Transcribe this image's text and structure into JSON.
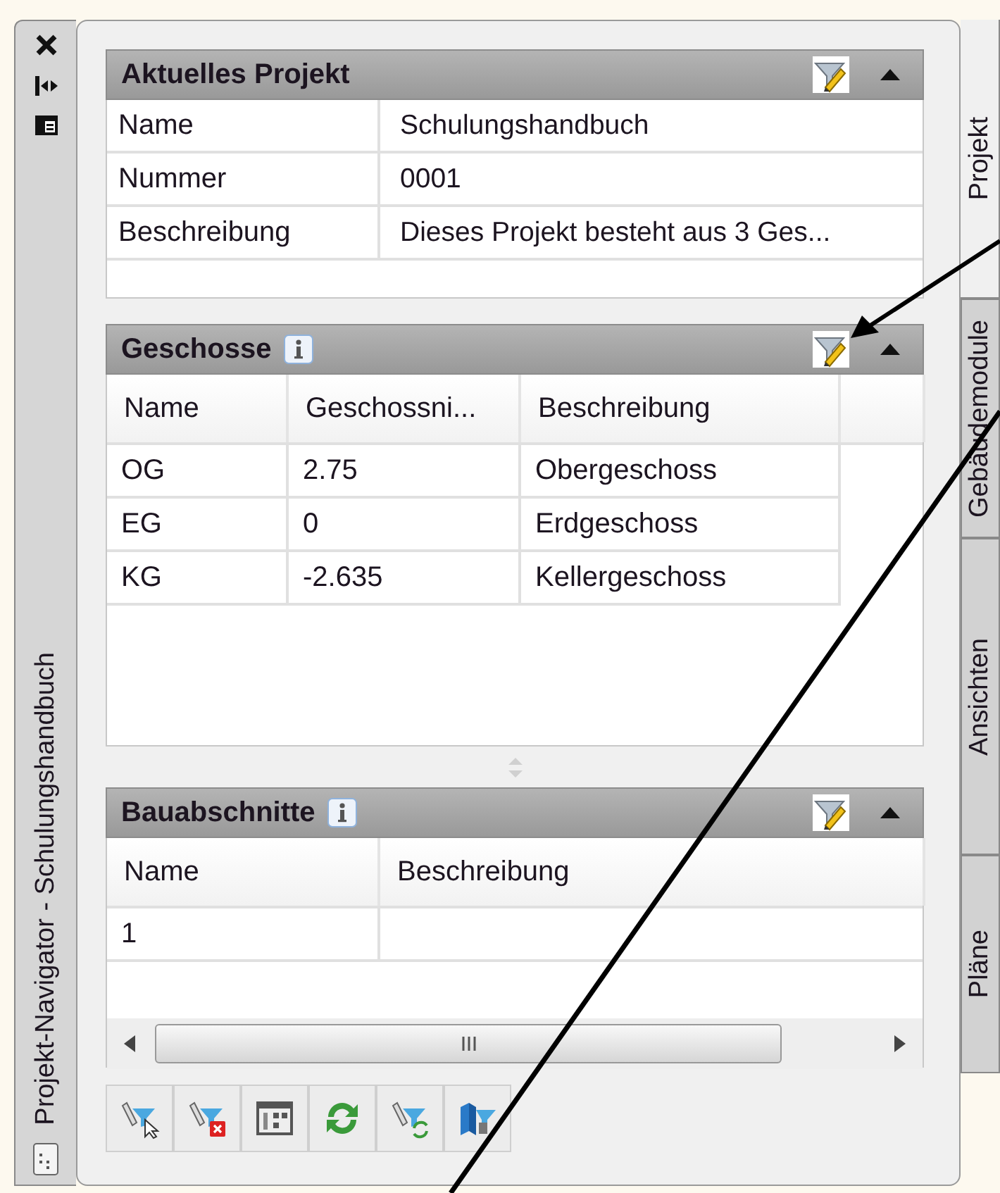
{
  "side_strip": {
    "title": "Projekt-Navigator - Schulungshandbuch"
  },
  "sections": [
    {
      "kind": "properties",
      "title": "Aktuelles Projekt",
      "info": false,
      "rows": [
        {
          "label": "Name",
          "value": "Schulungshandbuch"
        },
        {
          "label": "Nummer",
          "value": "0001"
        },
        {
          "label": "Beschreibung",
          "value": "Dieses Projekt besteht aus 3 Ges..."
        }
      ]
    },
    {
      "kind": "table",
      "title": "Geschosse",
      "info": true,
      "columns": [
        "Name",
        "Geschossni...",
        "Beschreibung"
      ],
      "rows": [
        [
          "OG",
          "2.75",
          "Obergeschoss"
        ],
        [
          "EG",
          "0",
          "Erdgeschoss"
        ],
        [
          "KG",
          "-2.635",
          "Kellergeschoss"
        ]
      ],
      "scrollbar": false
    },
    {
      "kind": "table",
      "title": "Bauabschnitte",
      "info": true,
      "columns": [
        "Name",
        "Beschreibung"
      ],
      "rows": [
        [
          "1"
        ]
      ],
      "scrollbar": true
    }
  ],
  "tabs": [
    {
      "label": "Projekt",
      "selected": true
    },
    {
      "label": "Gebäudemodule",
      "selected": false
    },
    {
      "label": "Ansichten",
      "selected": false
    },
    {
      "label": "Pläne",
      "selected": false
    }
  ]
}
